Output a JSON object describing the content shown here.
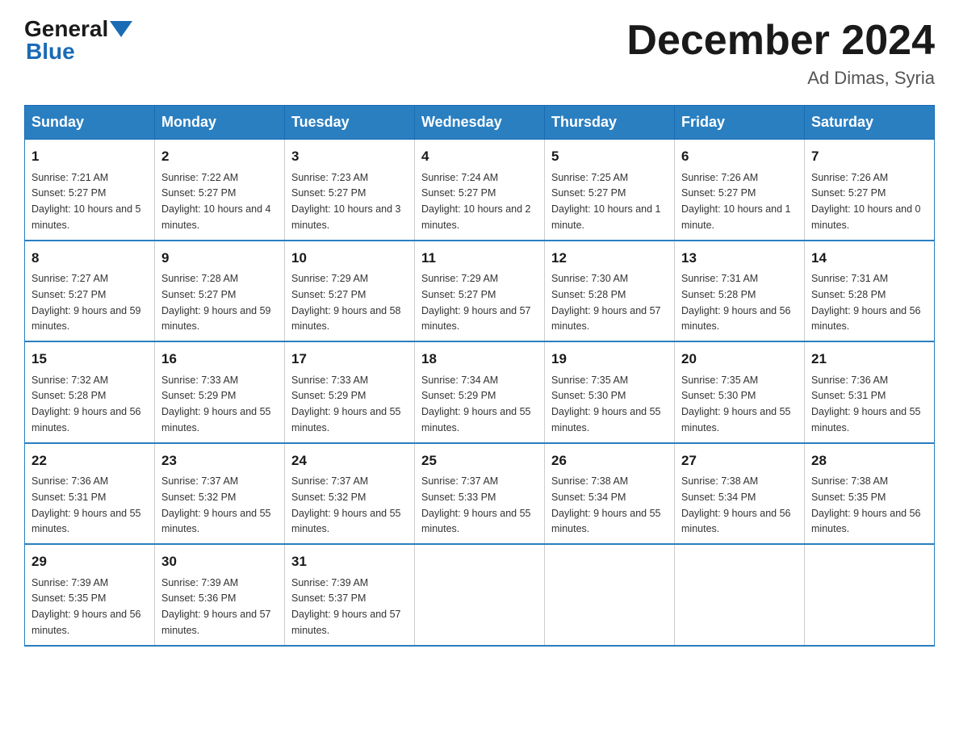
{
  "header": {
    "logo_general": "General",
    "logo_blue": "Blue",
    "month_title": "December 2024",
    "location": "Ad Dimas, Syria"
  },
  "days_of_week": [
    "Sunday",
    "Monday",
    "Tuesday",
    "Wednesday",
    "Thursday",
    "Friday",
    "Saturday"
  ],
  "weeks": [
    [
      {
        "day": "1",
        "sunrise": "7:21 AM",
        "sunset": "5:27 PM",
        "daylight": "10 hours and 5 minutes."
      },
      {
        "day": "2",
        "sunrise": "7:22 AM",
        "sunset": "5:27 PM",
        "daylight": "10 hours and 4 minutes."
      },
      {
        "day": "3",
        "sunrise": "7:23 AM",
        "sunset": "5:27 PM",
        "daylight": "10 hours and 3 minutes."
      },
      {
        "day": "4",
        "sunrise": "7:24 AM",
        "sunset": "5:27 PM",
        "daylight": "10 hours and 2 minutes."
      },
      {
        "day": "5",
        "sunrise": "7:25 AM",
        "sunset": "5:27 PM",
        "daylight": "10 hours and 1 minute."
      },
      {
        "day": "6",
        "sunrise": "7:26 AM",
        "sunset": "5:27 PM",
        "daylight": "10 hours and 1 minute."
      },
      {
        "day": "7",
        "sunrise": "7:26 AM",
        "sunset": "5:27 PM",
        "daylight": "10 hours and 0 minutes."
      }
    ],
    [
      {
        "day": "8",
        "sunrise": "7:27 AM",
        "sunset": "5:27 PM",
        "daylight": "9 hours and 59 minutes."
      },
      {
        "day": "9",
        "sunrise": "7:28 AM",
        "sunset": "5:27 PM",
        "daylight": "9 hours and 59 minutes."
      },
      {
        "day": "10",
        "sunrise": "7:29 AM",
        "sunset": "5:27 PM",
        "daylight": "9 hours and 58 minutes."
      },
      {
        "day": "11",
        "sunrise": "7:29 AM",
        "sunset": "5:27 PM",
        "daylight": "9 hours and 57 minutes."
      },
      {
        "day": "12",
        "sunrise": "7:30 AM",
        "sunset": "5:28 PM",
        "daylight": "9 hours and 57 minutes."
      },
      {
        "day": "13",
        "sunrise": "7:31 AM",
        "sunset": "5:28 PM",
        "daylight": "9 hours and 56 minutes."
      },
      {
        "day": "14",
        "sunrise": "7:31 AM",
        "sunset": "5:28 PM",
        "daylight": "9 hours and 56 minutes."
      }
    ],
    [
      {
        "day": "15",
        "sunrise": "7:32 AM",
        "sunset": "5:28 PM",
        "daylight": "9 hours and 56 minutes."
      },
      {
        "day": "16",
        "sunrise": "7:33 AM",
        "sunset": "5:29 PM",
        "daylight": "9 hours and 55 minutes."
      },
      {
        "day": "17",
        "sunrise": "7:33 AM",
        "sunset": "5:29 PM",
        "daylight": "9 hours and 55 minutes."
      },
      {
        "day": "18",
        "sunrise": "7:34 AM",
        "sunset": "5:29 PM",
        "daylight": "9 hours and 55 minutes."
      },
      {
        "day": "19",
        "sunrise": "7:35 AM",
        "sunset": "5:30 PM",
        "daylight": "9 hours and 55 minutes."
      },
      {
        "day": "20",
        "sunrise": "7:35 AM",
        "sunset": "5:30 PM",
        "daylight": "9 hours and 55 minutes."
      },
      {
        "day": "21",
        "sunrise": "7:36 AM",
        "sunset": "5:31 PM",
        "daylight": "9 hours and 55 minutes."
      }
    ],
    [
      {
        "day": "22",
        "sunrise": "7:36 AM",
        "sunset": "5:31 PM",
        "daylight": "9 hours and 55 minutes."
      },
      {
        "day": "23",
        "sunrise": "7:37 AM",
        "sunset": "5:32 PM",
        "daylight": "9 hours and 55 minutes."
      },
      {
        "day": "24",
        "sunrise": "7:37 AM",
        "sunset": "5:32 PM",
        "daylight": "9 hours and 55 minutes."
      },
      {
        "day": "25",
        "sunrise": "7:37 AM",
        "sunset": "5:33 PM",
        "daylight": "9 hours and 55 minutes."
      },
      {
        "day": "26",
        "sunrise": "7:38 AM",
        "sunset": "5:34 PM",
        "daylight": "9 hours and 55 minutes."
      },
      {
        "day": "27",
        "sunrise": "7:38 AM",
        "sunset": "5:34 PM",
        "daylight": "9 hours and 56 minutes."
      },
      {
        "day": "28",
        "sunrise": "7:38 AM",
        "sunset": "5:35 PM",
        "daylight": "9 hours and 56 minutes."
      }
    ],
    [
      {
        "day": "29",
        "sunrise": "7:39 AM",
        "sunset": "5:35 PM",
        "daylight": "9 hours and 56 minutes."
      },
      {
        "day": "30",
        "sunrise": "7:39 AM",
        "sunset": "5:36 PM",
        "daylight": "9 hours and 57 minutes."
      },
      {
        "day": "31",
        "sunrise": "7:39 AM",
        "sunset": "5:37 PM",
        "daylight": "9 hours and 57 minutes."
      },
      null,
      null,
      null,
      null
    ]
  ],
  "labels": {
    "sunrise": "Sunrise:",
    "sunset": "Sunset:",
    "daylight": "Daylight:"
  }
}
